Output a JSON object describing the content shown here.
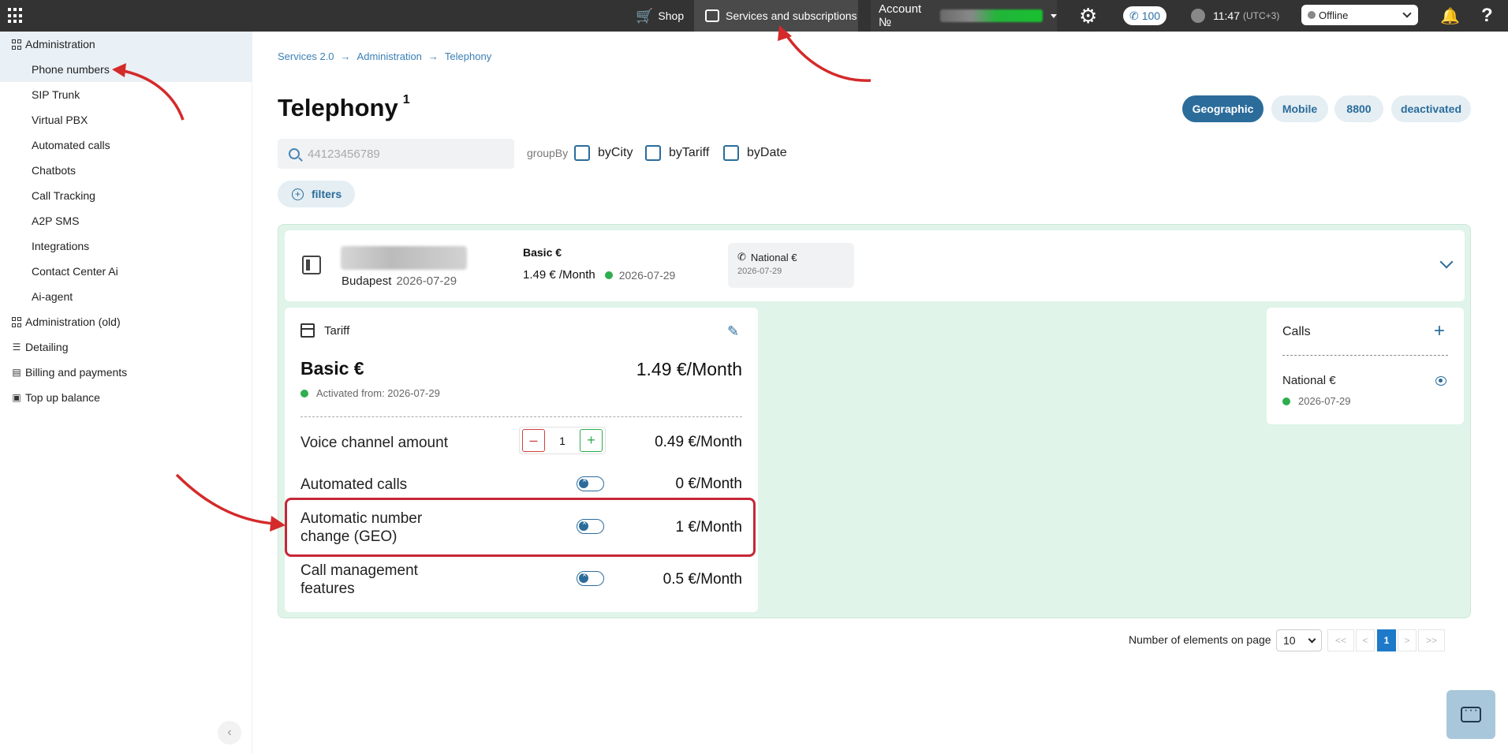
{
  "topbar": {
    "shop": "Shop",
    "services": "Services and subscriptions",
    "account_label": "Account №",
    "calls_count": "100",
    "time": "11:47",
    "timezone": "(UTC+3)",
    "status": "Offline",
    "help": "?"
  },
  "sidebar": {
    "sections": [
      {
        "label": "Administration"
      },
      {
        "label": "Administration (old)"
      },
      {
        "label": "Detailing"
      },
      {
        "label": "Billing and payments"
      },
      {
        "label": "Top up balance"
      }
    ],
    "items": [
      {
        "label": "Phone numbers"
      },
      {
        "label": "SIP Trunk"
      },
      {
        "label": "Virtual PBX"
      },
      {
        "label": "Automated calls"
      },
      {
        "label": "Chatbots"
      },
      {
        "label": "Call Tracking"
      },
      {
        "label": "A2P SMS"
      },
      {
        "label": "Integrations"
      },
      {
        "label": "Contact Center Ai"
      },
      {
        "label": "Ai-agent"
      }
    ]
  },
  "breadcrumb": [
    "Services 2.0",
    "Administration",
    "Telephony"
  ],
  "page": {
    "title": "Telephony",
    "title_sup": "1",
    "tabs": [
      "Geographic",
      "Mobile",
      "8800",
      "deactivated"
    ],
    "search_placeholder": "44123456789",
    "groupby_label": "groupBy",
    "groupby_options": [
      "byCity",
      "byTariff",
      "byDate"
    ],
    "filters_label": "filters"
  },
  "number": {
    "city": "Budapest",
    "city_date": "2026-07-29",
    "tariff_name": "Basic €",
    "tariff_price": "1.49 € /Month",
    "tariff_date": "2026-07-29",
    "package_name": "National €",
    "package_date": "2026-07-29"
  },
  "tariff_card": {
    "header": "Tariff",
    "name": "Basic €",
    "price": "1.49 €/Month",
    "activated": "Activated from: 2026-07-29",
    "rows": [
      {
        "label": "Voice channel amount",
        "price": "0.49 €/Month",
        "quantity": "1"
      },
      {
        "label": "Automated calls",
        "price": "0 €/Month"
      },
      {
        "label": "Automatic number change (GEO)",
        "price": "1 €/Month"
      },
      {
        "label": "Call management features",
        "price": "0.5 €/Month"
      }
    ]
  },
  "calls_card": {
    "title": "Calls",
    "item_name": "National €",
    "item_date": "2026-07-29"
  },
  "pagination": {
    "label": "Number of elements on page",
    "page_size": "10",
    "first": "<<",
    "prev": "<",
    "current": "1",
    "next": ">",
    "last": ">>"
  },
  "colors": {
    "accent": "#2b6c9b",
    "panel_green": "#e0f4e9",
    "highlight_red": "#c62737",
    "topbar": "#333333"
  }
}
